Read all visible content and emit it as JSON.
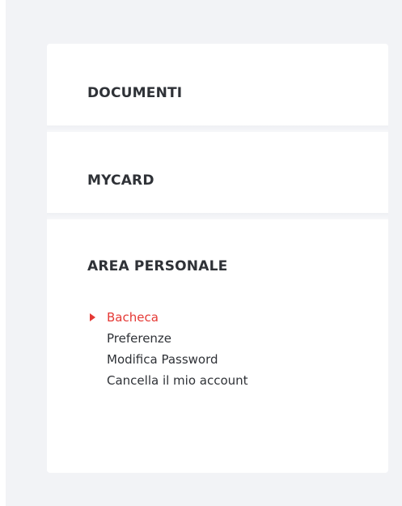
{
  "sidebar": {
    "sections": [
      {
        "title": "DOCUMENTI"
      },
      {
        "title": "MYCARD"
      },
      {
        "title": "AREA PERSONALE",
        "items": [
          {
            "label": "Bacheca",
            "active": true
          },
          {
            "label": "Preferenze",
            "active": false
          },
          {
            "label": "Modifica Password",
            "active": false
          },
          {
            "label": "Cancella il mio account",
            "active": false
          }
        ]
      }
    ],
    "colors": {
      "accent": "#e53935",
      "text": "#2f3237",
      "background": "#f2f3f6",
      "card": "#ffffff"
    },
    "icons": {
      "active_marker": "caret-right-icon"
    }
  }
}
